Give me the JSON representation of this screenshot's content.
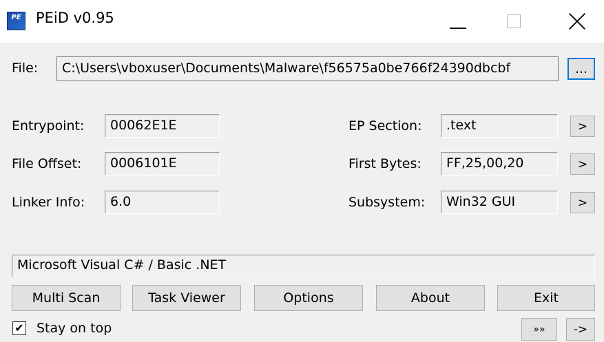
{
  "window": {
    "title": "PEiD v0.95",
    "icon_text": "PE"
  },
  "file": {
    "label": "File:",
    "path": "C:\\Users\\vboxuser\\Documents\\Malware\\f56575a0be766f24390dbcbf",
    "browse_label": "..."
  },
  "left_fields": [
    {
      "label": "Entrypoint:",
      "value": "00062E1E"
    },
    {
      "label": "File Offset:",
      "value": "0006101E"
    },
    {
      "label": "Linker Info:",
      "value": "6.0"
    }
  ],
  "right_fields": [
    {
      "label": "EP Section:",
      "value": ".text",
      "button": ">"
    },
    {
      "label": "First Bytes:",
      "value": "FF,25,00,20",
      "button": ">"
    },
    {
      "label": "Subsystem:",
      "value": "Win32 GUI",
      "button": ">"
    }
  ],
  "result": "Microsoft Visual C# / Basic .NET",
  "buttons": {
    "multi_scan": "Multi Scan",
    "task_viewer": "Task Viewer",
    "options": "Options",
    "about": "About",
    "exit": "Exit",
    "extra": "»»",
    "arrow": "->"
  },
  "stay_on_top": {
    "label": "Stay on top",
    "checked": true,
    "mark": "✔"
  }
}
